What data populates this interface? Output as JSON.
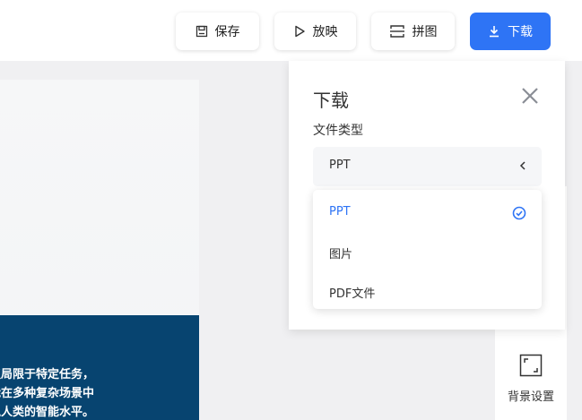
{
  "toolbar": {
    "save_label": "保存",
    "play_label": "放映",
    "puzzle_label": "拼图",
    "download_label": "下载"
  },
  "slide": {
    "lines": [
      "仅局限于特定任务，",
      "能在多种复杂场景中",
      "似人类的智能水平。"
    ]
  },
  "side": {
    "background_settings_label": "背景设置"
  },
  "download_panel": {
    "title": "下载",
    "file_type_label": "文件类型",
    "selected_value": "PPT",
    "options": [
      {
        "label": "PPT",
        "selected": true
      },
      {
        "label": "图片",
        "selected": false
      },
      {
        "label": "PDF文件",
        "selected": false
      }
    ]
  },
  "colors": {
    "accent": "#2e74f5",
    "slide_band": "#074470"
  }
}
